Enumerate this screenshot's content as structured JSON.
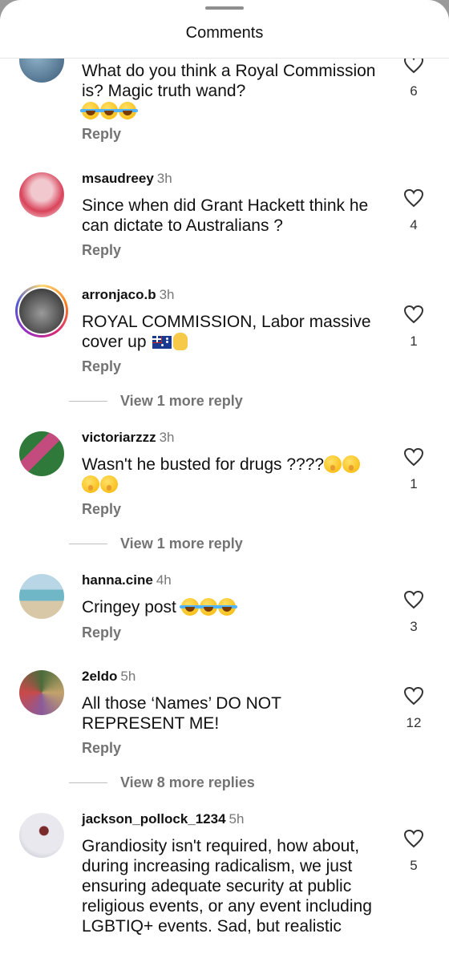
{
  "sheet": {
    "title": "Comments"
  },
  "comments": [
    {
      "username": "",
      "time": "",
      "text": "What do you think a Royal Commission is? Magic truth wand?",
      "emojis": "😂😂😂",
      "reply": "Reply",
      "likes": "6",
      "avatar_colors": [
        "#3a5a78",
        "#8fb3c9"
      ]
    },
    {
      "username": "msaudreey",
      "time": "3h",
      "text": "Since when did Grant Hackett think he can dictate to Australians ?",
      "reply": "Reply",
      "likes": "4",
      "avatar_colors": [
        "#f2c8cf",
        "#d9435a"
      ]
    },
    {
      "username": "arronjaco.b",
      "time": "3h",
      "text": "ROYAL COMMISSION, Labor massive cover up",
      "emojis": "🇦🇺✋",
      "reply": "Reply",
      "likes": "1",
      "avatar_colors": [
        "#444444",
        "#9a9a9a"
      ],
      "view_more": "View 1 more reply"
    },
    {
      "username": "victoriarzzz",
      "time": "3h",
      "text": "Wasn't he busted for drugs ????",
      "emojis": "🤫🤫🤫🤫",
      "reply": "Reply",
      "likes": "1",
      "avatar_colors": [
        "#2f7a3a",
        "#c44b7e"
      ],
      "view_more": "View 1 more reply"
    },
    {
      "username": "hanna.cine",
      "time": "4h",
      "text": "Cringey post",
      "emojis": "😂😂😂",
      "reply": "Reply",
      "likes": "3",
      "avatar_colors": [
        "#6fb7c7",
        "#d8c8a8"
      ]
    },
    {
      "username": "2eldo",
      "time": "5h",
      "text": "All those ‘Names’ DO NOT REPRESENT ME!",
      "reply": "Reply",
      "likes": "12",
      "avatar_colors": [
        "#4a6b3a",
        "#c2a36b"
      ],
      "view_more": "View 8 more replies"
    },
    {
      "username": "jackson_pollock_1234",
      "time": "5h",
      "text": "Grandiosity isn't required, how about, during increasing radicalism, we just ensuring adequate security at public religious events, or any event including LGBTIQ+ events. Sad, but realistic",
      "likes": "5",
      "avatar_colors": [
        "#e8e8ee",
        "#5b5b6b"
      ]
    }
  ]
}
